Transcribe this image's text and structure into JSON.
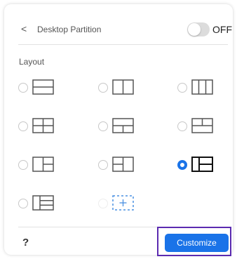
{
  "header": {
    "back_glyph": "<",
    "title": "Desktop Partition",
    "toggle_state": "OFF"
  },
  "layout": {
    "label": "Layout",
    "options": [
      {
        "name": "two-rows",
        "selected": false
      },
      {
        "name": "two-columns",
        "selected": false
      },
      {
        "name": "three-columns",
        "selected": false
      },
      {
        "name": "four-grid",
        "selected": false
      },
      {
        "name": "top-one-bottom-two",
        "selected": false
      },
      {
        "name": "top-two-bottom-one",
        "selected": false
      },
      {
        "name": "left-one-right-two",
        "selected": false
      },
      {
        "name": "left-two-right-one",
        "selected": false
      },
      {
        "name": "left-one-right-two-alt",
        "selected": true
      },
      {
        "name": "left-one-right-three",
        "selected": false
      },
      {
        "name": "custom-add",
        "selected": false,
        "disabled": true
      }
    ]
  },
  "footer": {
    "help": "?",
    "customize": "Customize"
  },
  "colors": {
    "accent": "#1a73e8",
    "highlight_frame": "#5b2bb0"
  }
}
